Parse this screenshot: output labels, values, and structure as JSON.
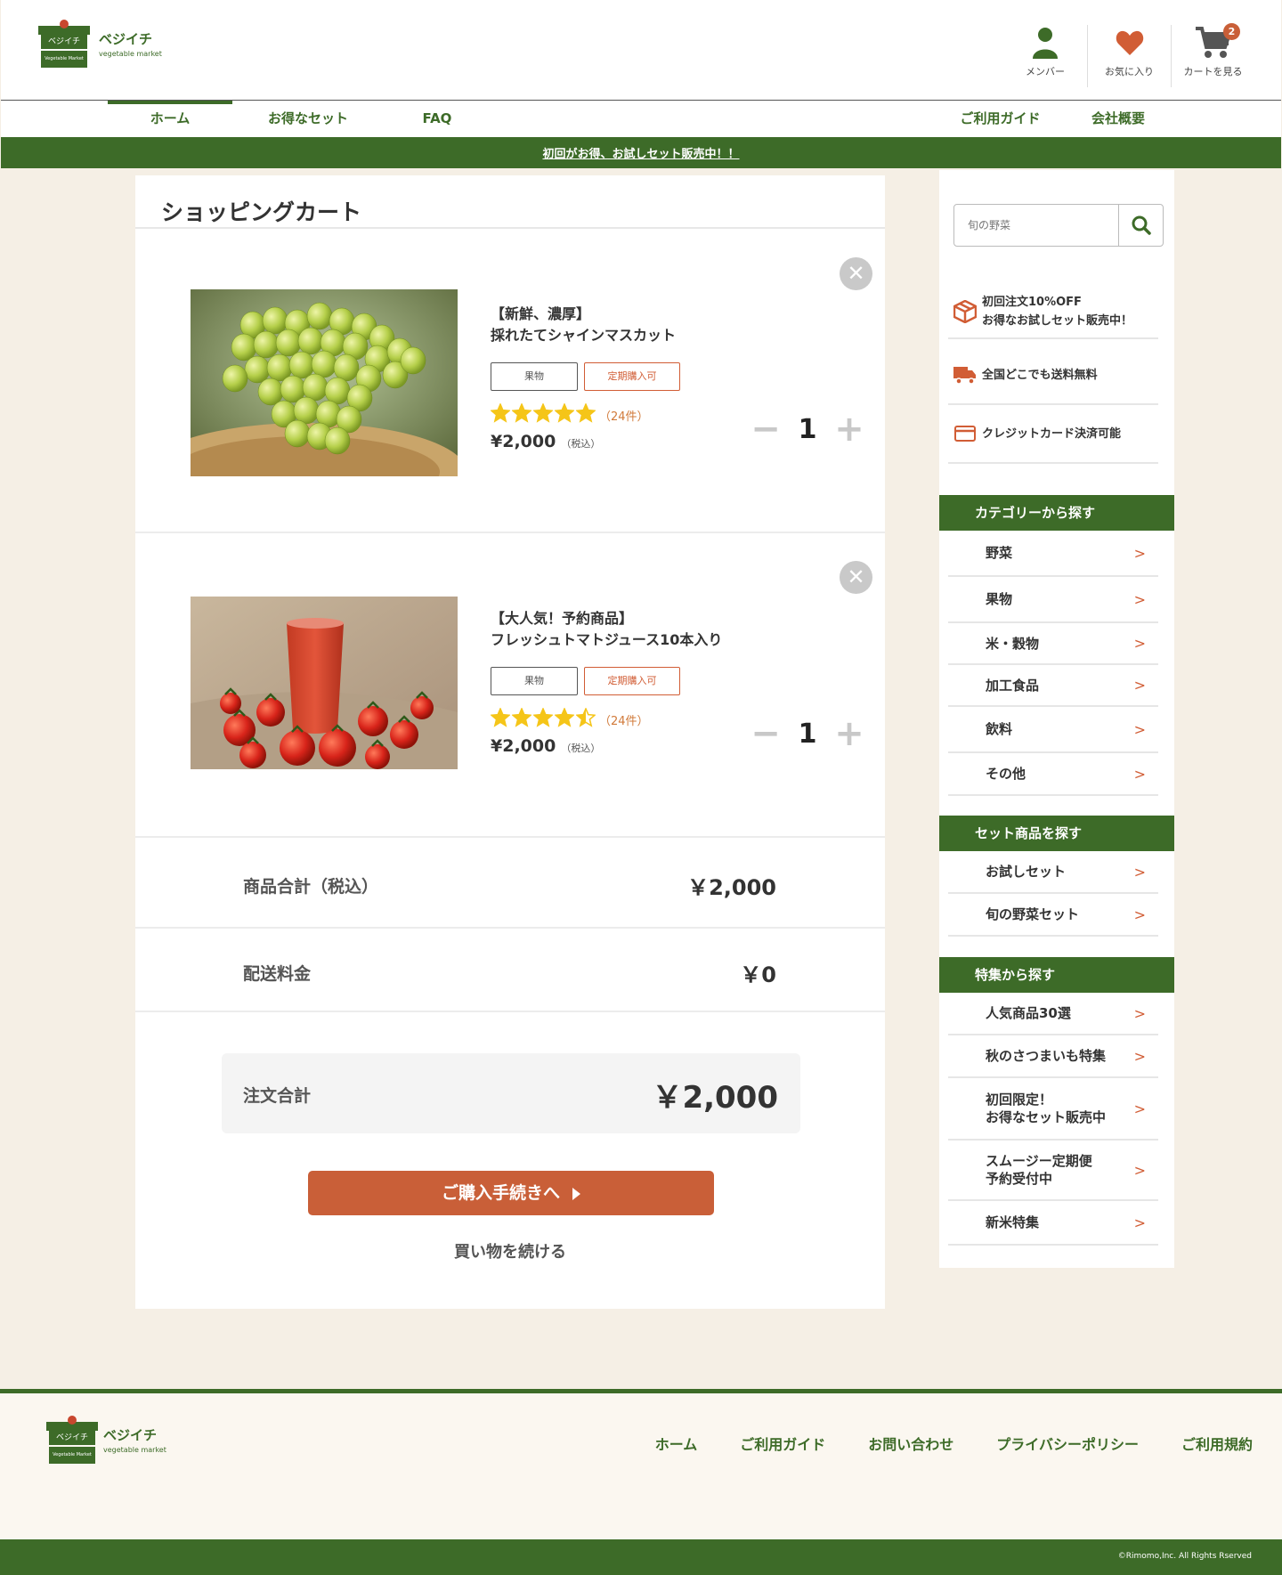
{
  "header": {
    "logo_sign": "ベジイチ",
    "logo_base": "Vegetable Market",
    "logo_name": "ベジイチ",
    "logo_sub": "vegetable market",
    "member_label": "メンバー",
    "favorite_label": "お気に入り",
    "cart_label": "カートを見る",
    "cart_count": "2"
  },
  "nav": {
    "home": "ホーム",
    "deals": "お得なセット",
    "faq": "FAQ",
    "guide": "ご利用ガイド",
    "company": "会社概要"
  },
  "banner": "初回がお得、お試しセット販売中！！",
  "cart": {
    "title": "ショッピングカート",
    "items": [
      {
        "name_line1": "【新鮮、濃厚】",
        "name_line2": "採れたてシャインマスカット",
        "tag1": "果物",
        "tag2": "定期購入可",
        "rating": 5,
        "review_count": "（24件）",
        "price": "¥2,000",
        "tax_note": "（税込）",
        "quantity": "1",
        "image": "shine-muscat-grapes"
      },
      {
        "name_line1": "【大人気！予約商品】",
        "name_line2": "フレッシュトマトジュース10本入り",
        "tag1": "果物",
        "tag2": "定期購入可",
        "rating": 4.5,
        "review_count": "（24件）",
        "price": "¥2,000",
        "tax_note": "（税込）",
        "quantity": "1",
        "image": "tomato-juice"
      }
    ],
    "subtotal_label": "商品合計（税込）",
    "subtotal_value": "￥2,000",
    "shipping_label": "配送料金",
    "shipping_value": "￥0",
    "total_label": "注文合計",
    "total_value": "￥2,000",
    "checkout_label": "ご購入手続きへ",
    "continue_label": "買い物を続ける"
  },
  "sidebar": {
    "search_placeholder": "旬の野菜",
    "features": [
      {
        "line1": "初回注文10%OFF",
        "line2": "お得なお試しセット販売中！",
        "icon": "box-icon"
      },
      {
        "line1": "全国どこでも送料無料",
        "line2": "",
        "icon": "truck-icon"
      },
      {
        "line1": "クレジットカード決済可能",
        "line2": "",
        "icon": "credit-card-icon"
      }
    ],
    "category_title": "カテゴリーから探す",
    "categories": [
      "野菜",
      "果物",
      "米・穀物",
      "加工食品",
      "飲料",
      "その他"
    ],
    "set_title": "セット商品を探す",
    "sets": [
      "お試しセット",
      "旬の野菜セット"
    ],
    "special_title": "特集から探す",
    "specials": [
      {
        "line1": "人気商品30選",
        "line2": ""
      },
      {
        "line1": "秋のさつまいも特集",
        "line2": ""
      },
      {
        "line1": "初回限定！",
        "line2": "お得なセット販売中"
      },
      {
        "line1": "スムージー定期便",
        "line2": "予約受付中"
      },
      {
        "line1": "新米特集",
        "line2": ""
      }
    ]
  },
  "footer": {
    "links": [
      "ホーム",
      "ご利用ガイド",
      "お問い合わせ",
      "プライバシーポリシー",
      "ご利用規約"
    ],
    "copyright": "©Rimomo,Inc. All Rights Rserved"
  },
  "colors": {
    "brand_green": "#3d6b28",
    "accent_orange": "#c95f38",
    "star_yellow": "#f5c518"
  }
}
